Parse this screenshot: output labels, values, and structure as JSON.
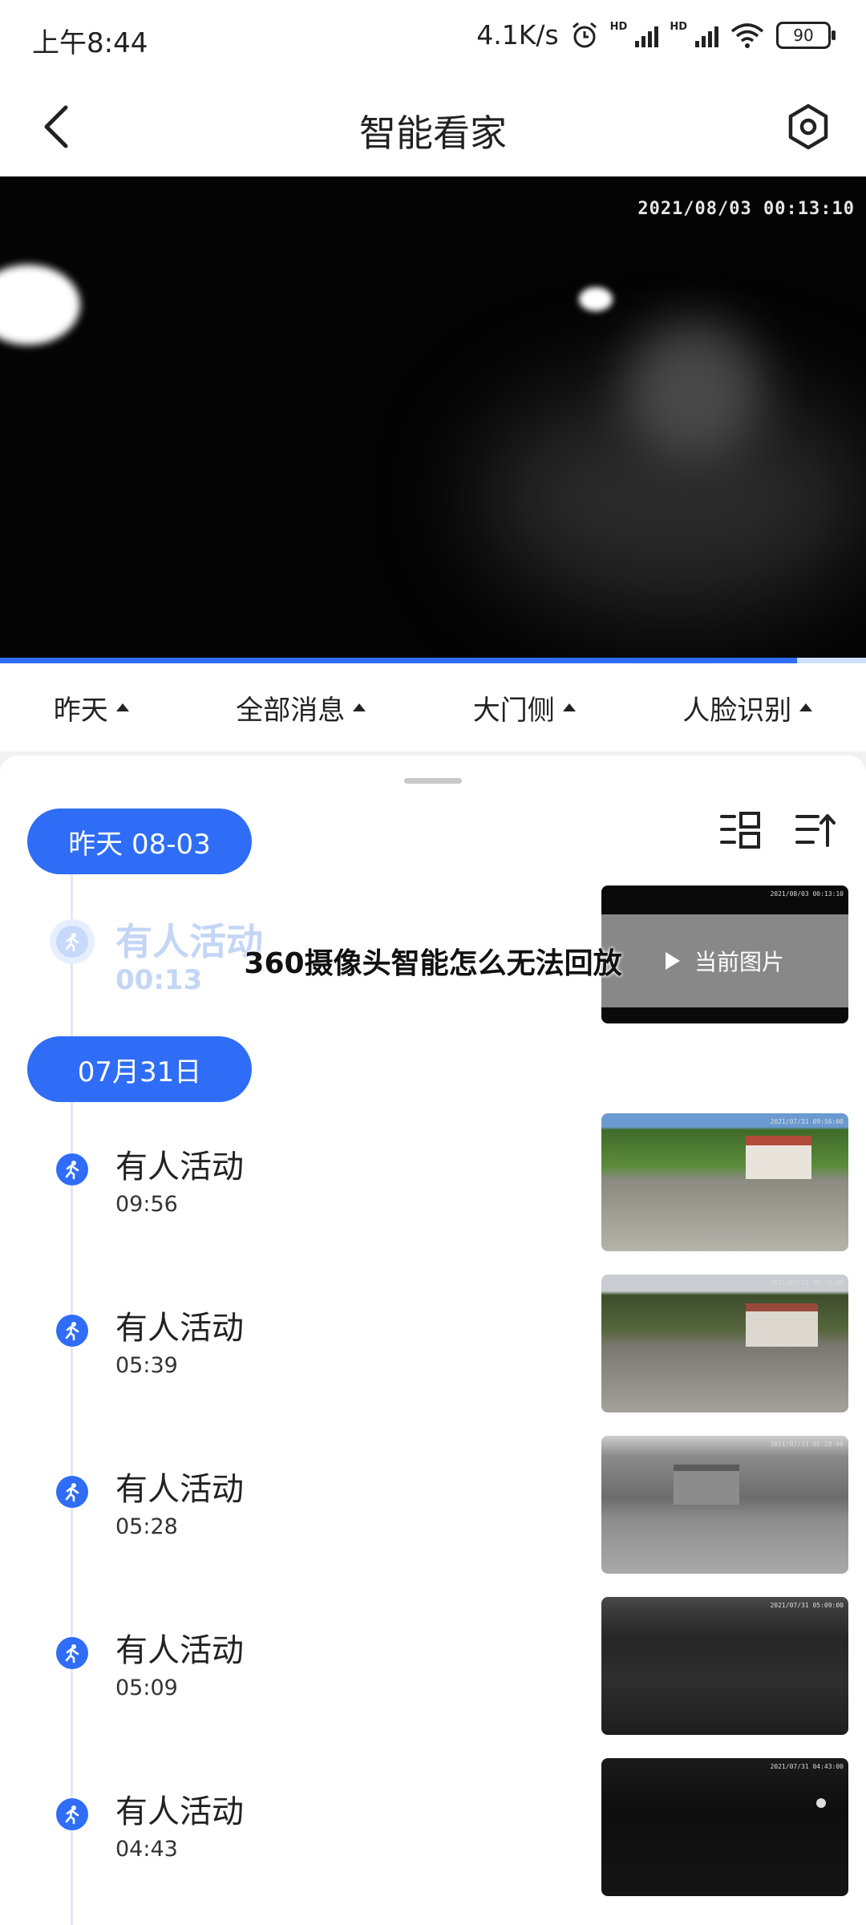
{
  "status_bar": {
    "time": "上午8:44",
    "net_speed": "4.1K/s",
    "signal_label": "HD",
    "battery": "90"
  },
  "header": {
    "title": "智能看家"
  },
  "video": {
    "timestamp": "2021/08/03  00:13:10",
    "progress_fraction": 0.92
  },
  "filters": [
    {
      "label": "昨天"
    },
    {
      "label": "全部消息"
    },
    {
      "label": "大门侧"
    },
    {
      "label": "人脸识别"
    }
  ],
  "groups": [
    {
      "date_label": "昨天 08-03"
    },
    {
      "date_label": "07月31日"
    }
  ],
  "current_event": {
    "title": "有人活动",
    "time": "00:13",
    "overlay_label": "当前图片",
    "thumb_stamp": "2021/08/03 00:13:10"
  },
  "events": [
    {
      "title": "有人活动",
      "time": "09:56",
      "thumb_stamp": "2021/07/31 09:56:00"
    },
    {
      "title": "有人活动",
      "time": "05:39",
      "thumb_stamp": "2021/07/31 05:39:00"
    },
    {
      "title": "有人活动",
      "time": "05:28",
      "thumb_stamp": "2021/07/31 05:28:00"
    },
    {
      "title": "有人活动",
      "time": "05:09",
      "thumb_stamp": "2021/07/31 05:09:00"
    },
    {
      "title": "有人活动",
      "time": "04:43",
      "thumb_stamp": "2021/07/31 04:43:00"
    }
  ],
  "watermark_text": "360摄像头智能怎么无法回放",
  "colors": {
    "accent": "#2f6df6",
    "accent_light": "#c4d6f5"
  }
}
